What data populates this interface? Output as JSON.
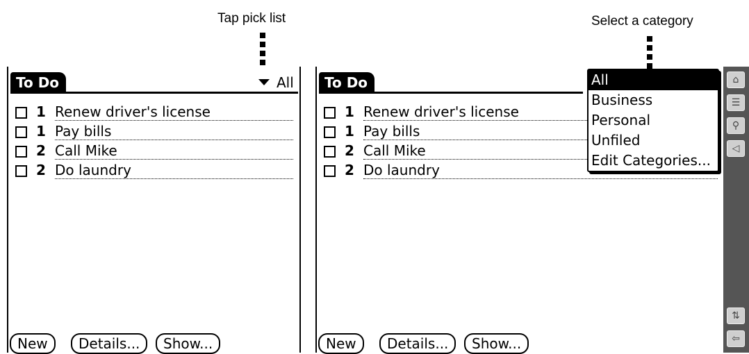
{
  "captions": {
    "left": "Tap pick list",
    "right": "Select a category"
  },
  "app": {
    "title": "To Do",
    "category_selected": "All",
    "tasks": [
      {
        "priority": "1",
        "text": "Renew driver's license"
      },
      {
        "priority": "1",
        "text": "Pay bills"
      },
      {
        "priority": "2",
        "text": "Call Mike"
      },
      {
        "priority": "2",
        "text": "Do laundry"
      }
    ],
    "buttons": {
      "new": "New",
      "details": "Details...",
      "show": "Show..."
    }
  },
  "category_popup": {
    "items": [
      "All",
      "Business",
      "Personal",
      "Unfiled",
      "Edit Categories..."
    ]
  },
  "silkscreen_icons": [
    "home-icon",
    "menu-icon",
    "find-icon",
    "volume-icon",
    "rotate-icon",
    "back-icon"
  ]
}
